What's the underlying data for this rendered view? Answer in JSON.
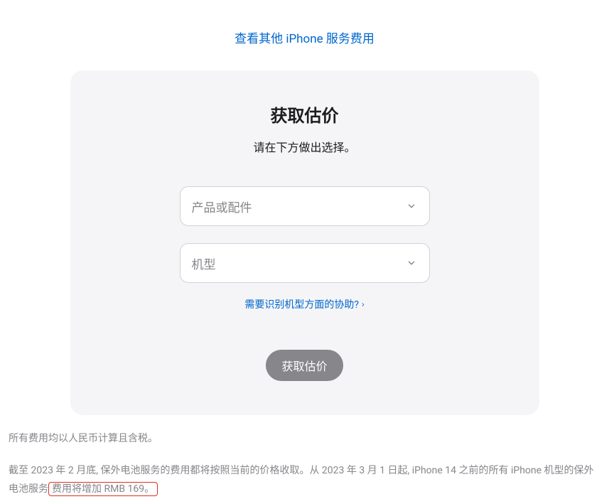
{
  "topLink": {
    "text": "查看其他 iPhone 服务费用"
  },
  "card": {
    "title": "获取估价",
    "subtitle": "请在下方做出选择。",
    "select1Placeholder": "产品或配件",
    "select2Placeholder": "机型",
    "helpLinkText": "需要识别机型方面的协助?",
    "submitButton": "获取估价"
  },
  "footer": {
    "para1": "所有费用均以人民币计算且含税。",
    "para2_part1": "截至 2023 年 2 月底, 保外电池服务的费用都将按照当前的价格收取。从 2023 年 3 月 1 日起, iPhone 14 之前的所有 iPhone 机型的保外电池服务",
    "para2_highlight": "费用将增加 RMB 169。"
  }
}
